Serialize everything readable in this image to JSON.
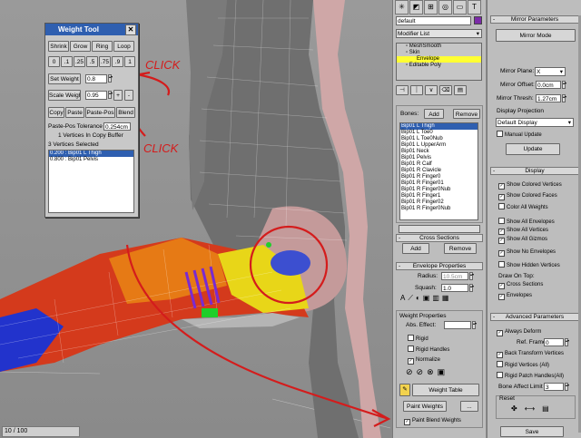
{
  "viewport": {
    "frame_counter": "10 / 100",
    "annotations": {
      "click_top": "CLICK",
      "click_bottom": "CLICK"
    }
  },
  "weight_tool": {
    "title": "Weight Tool",
    "row1": [
      "Shrink",
      "Grow",
      "Ring",
      "Loop"
    ],
    "row2": [
      "0",
      ".1",
      ".25",
      ".5",
      ".75",
      ".9",
      "1"
    ],
    "set_weight_label": "Set Weight",
    "set_weight_value": "0.8",
    "scale_weight_label": "Scale Weight",
    "scale_weight_value": "0.95",
    "row3": [
      "Copy",
      "Paste",
      "Paste-Pos",
      "Blend"
    ],
    "paste_pos_tolerance_label": "Paste-Pos Tolerance",
    "paste_pos_tolerance_value": "0.254cm",
    "copy_buffer_text": "1 Vertices In Copy Buffer",
    "vertices_selected": "3 Vertices Selected",
    "weights_list": [
      "0.200 : Bip01 L Thigh",
      "0.800 : Bip01 Pelvis"
    ]
  },
  "modifier_panel": {
    "object_name": "default",
    "modifier_list_label": "Modifier List",
    "stack": [
      "MeshSmooth",
      "Skin",
      "Envelope",
      "Editable Poly"
    ],
    "bones_label": "Bones:",
    "add_label": "Add",
    "remove_label": "Remove",
    "bones": [
      "Bip01 L Thigh",
      "Bip01 L Toe0",
      "Bip01 L Toe0Nub",
      "Bip01 L UpperArm",
      "Bip01 Neck",
      "Bip01 Pelvis",
      "Bip01 R Calf",
      "Bip01 R Clavicle",
      "Bip01 R Finger0",
      "Bip01 R Finger01",
      "Bip01 R Finger0Nub",
      "Bip01 R Finger1",
      "Bip01 R Finger02",
      "Bip01 R Finger0Nub"
    ],
    "cross_sections_label": "Cross Sections",
    "cs_add": "Add",
    "cs_remove": "Remove",
    "envelope_properties_label": "Envelope Properties",
    "radius_label": "Radius:",
    "radius_value": "10.5cm",
    "squash_label": "Squash:",
    "squash_value": "1.0",
    "weight_properties_label": "Weight Properties",
    "abs_effect_label": "Abs. Effect:",
    "rigid_label": "Rigid",
    "rigid_handles_label": "Rigid Handles",
    "normalize_label": "Normalize",
    "weight_table_label": "Weight Table",
    "paint_weights_label": "Paint Weights",
    "paint_blend_weights_label": "Paint Blend Weights"
  },
  "right_panel": {
    "mirror_parameters_label": "Mirror Parameters",
    "mirror_mode_label": "Mirror Mode",
    "mirror_plane_label": "Mirror Plane:",
    "mirror_plane_value": "X",
    "mirror_offset_label": "Mirror Offset:",
    "mirror_offset_value": "0.0cm",
    "mirror_thresh_label": "Mirror Thresh:",
    "mirror_thresh_value": "1.27cm",
    "display_projection_label": "Display Projection",
    "display_projection_value": "Default Display",
    "manual_update_label": "Manual Update",
    "update_label": "Update",
    "display_label": "Display",
    "display_items": [
      {
        "label": "Show Colored Vertices",
        "checked": true
      },
      {
        "label": "Show Colored Faces",
        "checked": true
      },
      {
        "label": "Color All Weights",
        "checked": false
      },
      {
        "label": "Show All Envelopes",
        "checked": false
      },
      {
        "label": "Show All Vertices",
        "checked": true
      },
      {
        "label": "Show All Gizmos",
        "checked": true
      },
      {
        "label": "Show No Envelopes",
        "checked": true
      },
      {
        "label": "Show Hidden Vertices",
        "checked": false
      }
    ],
    "draw_on_top_label": "Draw On Top:",
    "cross_sections_label": "Cross Sections",
    "envelopes_label": "Envelopes",
    "advanced_parameters_label": "Advanced Parameters",
    "always_deform_label": "Always Deform",
    "ref_frame_label": "Ref. Frame",
    "ref_frame_value": "0",
    "back_transform_label": "Back Transform Vertices",
    "rigid_vertices_label": "Rigid Vertices (All)",
    "rigid_patch_label": "Rigid Patch Handles(All)",
    "bone_affect_limit_label": "Bone Affect Limit",
    "bone_affect_limit_value": "3",
    "reset_label": "Reset",
    "save_label": "Save"
  },
  "colors": {
    "accent": "#2f5fb0",
    "highlight": "#ffff33",
    "annotation_red": "#d41c1c",
    "swatch": "#7b2aa8"
  }
}
